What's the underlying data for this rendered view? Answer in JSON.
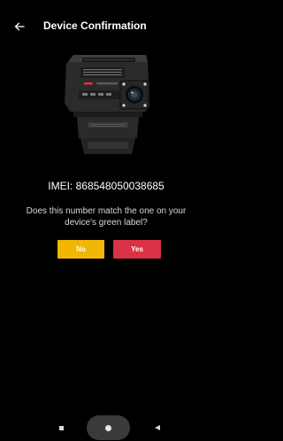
{
  "header": {
    "title": "Device Confirmation",
    "back_icon": "arrow-left-icon"
  },
  "device": {
    "image_icon": "dashcam-device-image"
  },
  "imei": {
    "text": "IMEI: 868548050038685"
  },
  "prompt": {
    "question": "Does this number match the one on your device's green label?"
  },
  "actions": {
    "no_label": "No",
    "yes_label": "Yes",
    "no_color": "#f2b705",
    "yes_color": "#d93244"
  },
  "navbar": {
    "recent_icon": "square-icon",
    "home_icon": "home-pill-icon",
    "back_icon": "triangle-back-icon"
  }
}
